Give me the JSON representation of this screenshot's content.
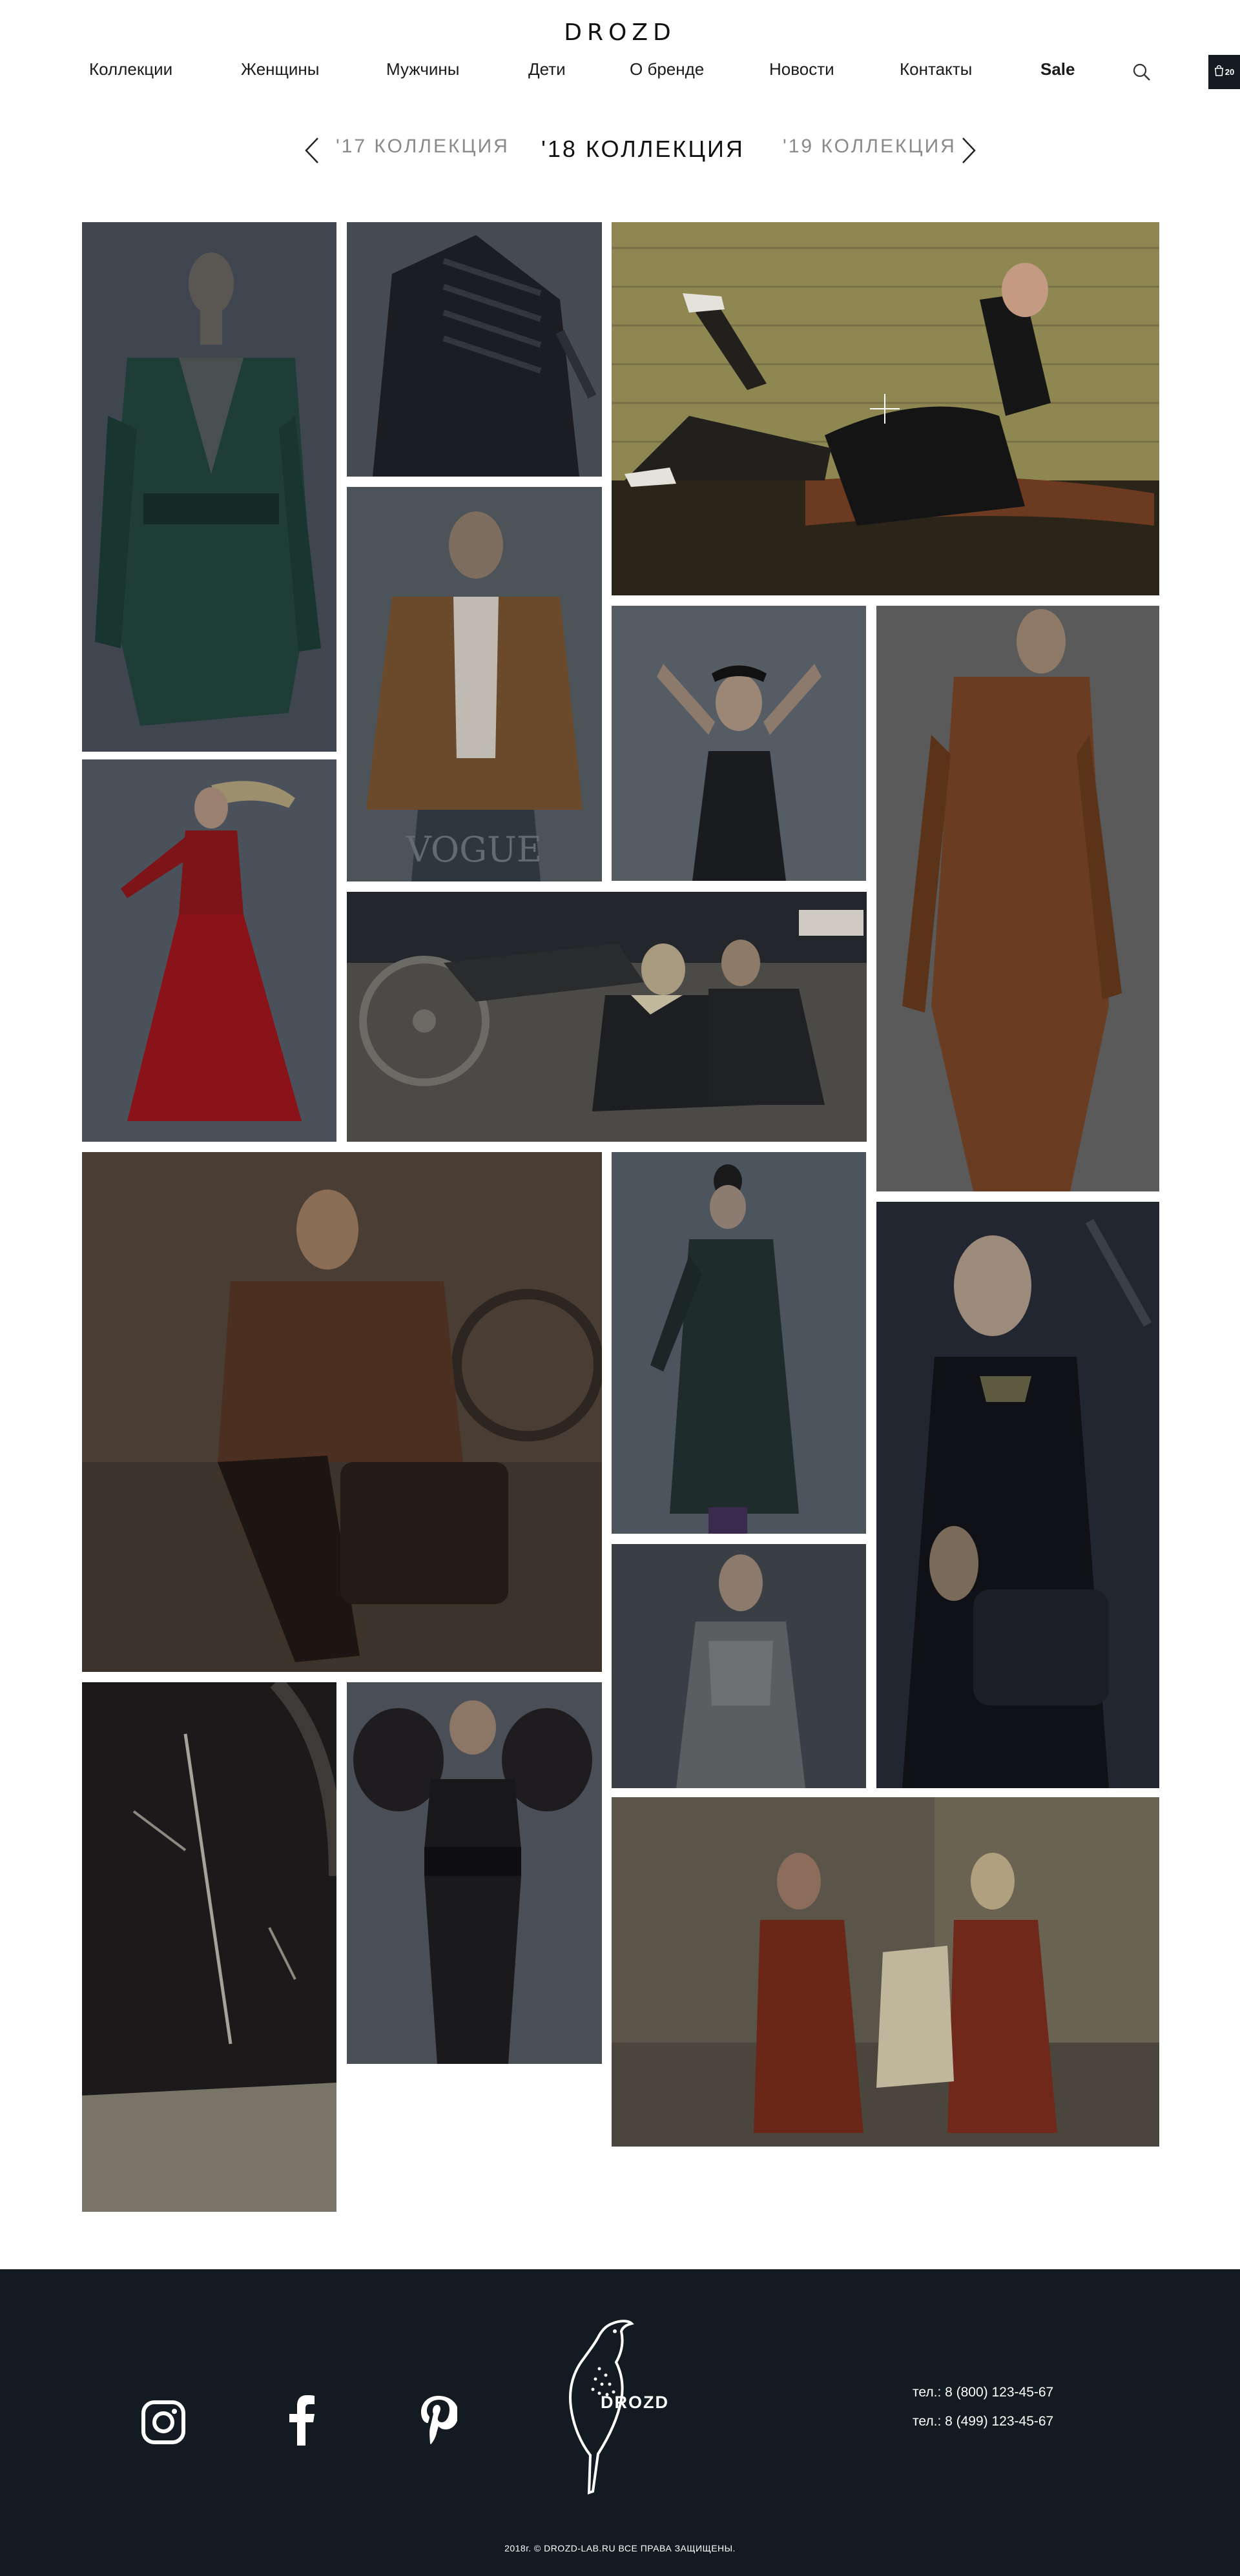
{
  "brand": "DROZD",
  "nav": {
    "items": [
      {
        "label": "Коллекции"
      },
      {
        "label": "Женщины"
      },
      {
        "label": "Мужчины"
      },
      {
        "label": "Дети"
      },
      {
        "label": "О бренде"
      },
      {
        "label": "Новости"
      },
      {
        "label": "Контакты"
      },
      {
        "label": "Sale"
      }
    ],
    "search_icon": "search-icon",
    "cart": {
      "icon": "shopping-bag-icon",
      "count": "20"
    }
  },
  "collections": {
    "prev": "'17 КОЛЛЕКЦИЯ",
    "current": "'18 КОЛЛЕКЦИЯ",
    "next": "'19 КОЛЛЕКЦИЯ",
    "prev_icon": "chevron-left-icon",
    "next_icon": "chevron-right-icon"
  },
  "gallery": {
    "overlay_icon": "plus-icon",
    "watermark": "VOGUE"
  },
  "footer": {
    "social": [
      {
        "name": "instagram-icon"
      },
      {
        "name": "facebook-icon"
      },
      {
        "name": "pinterest-icon"
      }
    ],
    "logo_icon": "thrush-bird-icon",
    "brand": "DROZD",
    "phones": [
      "тел.: 8 (800) 123-45-67",
      "тел.: 8 (499) 123-45-67"
    ],
    "copyright": "2018г. © DROZD-LAB.RU ВСЕ ПРАВА ЗАЩИЩЕНЫ."
  },
  "colors": {
    "footer_bg": "#141a22",
    "text": "#111111",
    "muted": "#8a8a8a"
  }
}
